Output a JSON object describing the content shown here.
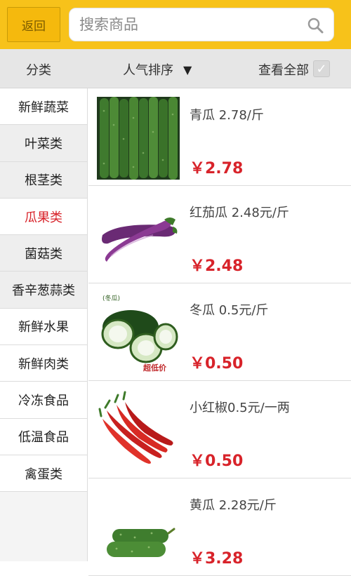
{
  "header": {
    "back_label": "返回",
    "search_placeholder": "搜索商品"
  },
  "filter": {
    "category_label": "分类",
    "sort_label": "人气排序",
    "view_all_label": "查看全部"
  },
  "sidebar": {
    "items": [
      {
        "label": "新鲜蔬菜"
      },
      {
        "label": "叶菜类"
      },
      {
        "label": "根茎类"
      },
      {
        "label": "瓜果类"
      },
      {
        "label": "菌菇类"
      },
      {
        "label": "香辛葱蒜类"
      },
      {
        "label": "新鲜水果"
      },
      {
        "label": "新鲜肉类"
      },
      {
        "label": "冷冻食品"
      },
      {
        "label": "低温食品"
      },
      {
        "label": "禽蛋类"
      }
    ],
    "active_index": 3
  },
  "products": [
    {
      "name": "青瓜 2.78/斤",
      "price": "￥2.78",
      "icon": "cucumber-image"
    },
    {
      "name": "红茄瓜 2.48元/斤",
      "price": "￥2.48",
      "icon": "eggplant-image"
    },
    {
      "name": "冬瓜 0.5元/斤",
      "price": "￥0.50",
      "icon": "winter-melon-image",
      "image_caption": "(冬瓜)",
      "image_tag": "超低价"
    },
    {
      "name": "小红椒0.5元/一两",
      "price": "￥0.50",
      "icon": "red-pepper-image"
    },
    {
      "name": "黄瓜 2.28元/斤",
      "price": "￥3.28",
      "icon": "yellow-cucumber-image"
    }
  ],
  "colors": {
    "accent": "#f7c21a",
    "price_red": "#d8232a"
  }
}
